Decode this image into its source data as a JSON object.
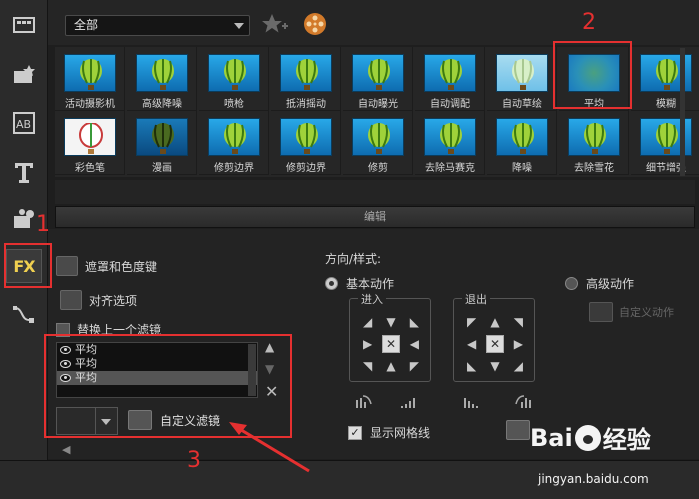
{
  "toolbar": {
    "category_value": "全部"
  },
  "effects_row1": [
    {
      "label": "活动摄影机",
      "thumb": "balloon"
    },
    {
      "label": "高级降噪",
      "thumb": "balloon"
    },
    {
      "label": "喷枪",
      "thumb": "balloon"
    },
    {
      "label": "抵消摇动",
      "thumb": "balloon"
    },
    {
      "label": "自动曝光",
      "thumb": "balloon"
    },
    {
      "label": "自动调配",
      "thumb": "balloon"
    },
    {
      "label": "自动草绘",
      "thumb": "balloon-light"
    },
    {
      "label": "平均",
      "thumb": "blur"
    },
    {
      "label": "模糊",
      "thumb": "balloon"
    }
  ],
  "effects_row2": [
    {
      "label": "彩色笔",
      "thumb": "balloon-white"
    },
    {
      "label": "漫画",
      "thumb": "balloon-dark"
    },
    {
      "label": "修剪边界",
      "thumb": "balloon"
    },
    {
      "label": "修剪边界",
      "thumb": "balloon"
    },
    {
      "label": "修剪",
      "thumb": "balloon"
    },
    {
      "label": "去除马赛克",
      "thumb": "balloon"
    },
    {
      "label": "降噪",
      "thumb": "balloon"
    },
    {
      "label": "去除雪花",
      "thumb": "balloon"
    },
    {
      "label": "细节增强",
      "thumb": "balloon"
    }
  ],
  "edit": {
    "header": "编辑",
    "mask_label": "遮罩和色度键",
    "align_label": "对齐选项",
    "replace_label": "替换上一个滤镜",
    "filters": [
      "平均",
      "平均",
      "平均"
    ],
    "custom_filter_label": "自定义滤镜"
  },
  "direction": {
    "title": "方向/样式:",
    "basic_label": "基本动作",
    "advanced_label": "高级动作",
    "in_label": "进入",
    "out_label": "退出",
    "custom_motion_label": "自定义动作",
    "grid_label": "显示网格线"
  },
  "annotations": [
    "1",
    "2",
    "3"
  ],
  "watermark": {
    "brand_left": "Bai",
    "brand_right": "经验",
    "url": "jingyan.baidu.com"
  },
  "colors": {
    "accent_red": "#e53030",
    "thumb_blue": "#1a8ad0"
  }
}
